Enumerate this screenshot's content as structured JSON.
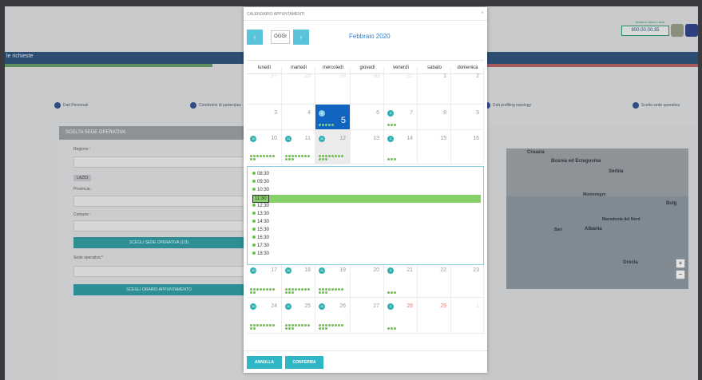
{
  "background": {
    "phone_label": "Numero Unico Lazio",
    "phone_number": "800.00.00.35",
    "nav_text": "le richieste",
    "steps": [
      "Dati Personali",
      "Condizioni di partecipaz",
      "Dati profiling topology",
      "Scelta sede operativa"
    ],
    "form_title": "SCELTA SEDE OPERATIVA",
    "regione_label": "Regione :",
    "lazio_tag": "LAZIO",
    "provincia_label": "Provincia :",
    "comune_label": "Comune :",
    "choose_sede_button": "SCEGLI SEDE OPERATIVA (1/3)",
    "sede_label": "Sede operativa:*",
    "choose_orario_button": "SCEGLI ORARIO APPUNTAMENTO",
    "map_labels": [
      "Croazia",
      "Bosnia ed Erzegovina",
      "Serbia",
      "Montenegro",
      "Bulg",
      "Macedonia del Nord",
      "Albania",
      "Grecia",
      "Bari"
    ]
  },
  "modal": {
    "title": "CALENDARIO APPUNTAMENTI",
    "close": "×",
    "prev": "‹",
    "today_label": "OGGI",
    "next": "›",
    "month": "Febbraio 2020",
    "weekdays": [
      "lunedì",
      "martedì",
      "mercoledì",
      "giovedì",
      "venerdì",
      "sabato",
      "domenica"
    ],
    "weeks": [
      [
        {
          "n": "27",
          "other": true
        },
        {
          "n": "28",
          "other": true
        },
        {
          "n": "29",
          "other": true
        },
        {
          "n": "30",
          "other": true
        },
        {
          "n": "31",
          "other": true
        },
        {
          "n": "1"
        },
        {
          "n": "2"
        }
      ],
      [
        {
          "n": "3"
        },
        {
          "n": "4"
        },
        {
          "n": "5",
          "badge": "5",
          "dots": 5,
          "selected": true
        },
        {
          "n": "6"
        },
        {
          "n": "7",
          "badge": "3",
          "dots": 3
        },
        {
          "n": "8"
        },
        {
          "n": "9"
        }
      ],
      [
        {
          "n": "10",
          "badge": "10",
          "dots": 10
        },
        {
          "n": "11",
          "badge": "11",
          "dots": 11
        },
        {
          "n": "12",
          "today": true,
          "badge": "11",
          "dots": 11
        },
        {
          "n": "13"
        },
        {
          "n": "14",
          "badge": "3",
          "dots": 3
        },
        {
          "n": "15"
        },
        {
          "n": "16"
        }
      ],
      [
        {
          "n": "17",
          "badge": "10",
          "dots": 10
        },
        {
          "n": "18",
          "badge": "11",
          "dots": 11
        },
        {
          "n": "19",
          "badge": "11",
          "dots": 11
        },
        {
          "n": "20"
        },
        {
          "n": "21",
          "badge": "3",
          "dots": 3
        },
        {
          "n": "22"
        },
        {
          "n": "23"
        }
      ],
      [
        {
          "n": "24",
          "badge": "10",
          "dots": 10
        },
        {
          "n": "25",
          "badge": "11",
          "dots": 11
        },
        {
          "n": "26",
          "badge": "11",
          "dots": 11
        },
        {
          "n": "27"
        },
        {
          "n": "28",
          "badge": "3",
          "dots": 3,
          "holiday": true
        },
        {
          "n": "29",
          "holiday": true
        },
        {
          "n": "1",
          "other": true
        }
      ]
    ],
    "slots": [
      "08:30",
      "09:30",
      "10:30",
      "11:30",
      "12:30",
      "13:30",
      "14:30",
      "15:30",
      "16:30",
      "17:30",
      "18:30"
    ],
    "selected_slot": "11:30",
    "cancel_label": "ANNULLA",
    "confirm_label": "CONFERMA"
  },
  "colors": {
    "accent": "#59c3d9",
    "selected_day": "#1165c1",
    "availability": "#6cc24a",
    "badge": "#32b0b0",
    "footer_button": "#2fb6c4"
  }
}
